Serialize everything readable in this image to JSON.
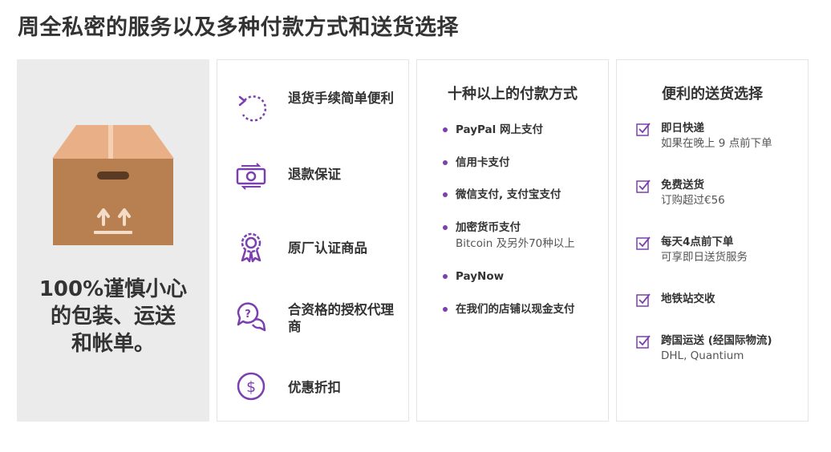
{
  "page": {
    "title": "周全私密的服务以及多种付款方式和送货选择"
  },
  "colors": {
    "accent": "#7b3fb0",
    "box_dark": "#b88050",
    "box_light": "#e9b088",
    "panel_bg": "#ebebeb"
  },
  "packaging": {
    "lines": [
      "100%谨慎小心",
      "的包装、运送",
      "和帐单。"
    ],
    "icon": "cardboard-box-icon"
  },
  "features": [
    {
      "label": "退货手续简单便利",
      "icon": "return-arrow-icon"
    },
    {
      "label": "退款保证",
      "icon": "money-refund-icon"
    },
    {
      "label": "原厂认证商品",
      "icon": "badge-ribbon-icon"
    },
    {
      "label": "合资格的授权代理商",
      "icon": "chat-question-icon"
    },
    {
      "label": "优惠折扣",
      "icon": "dollar-coin-icon"
    }
  ],
  "payment": {
    "heading": "十种以上的付款方式",
    "items": [
      {
        "main": "PayPal 网上支付",
        "sub": ""
      },
      {
        "main": "信用卡支付",
        "sub": ""
      },
      {
        "main": "微信支付, 支付宝支付",
        "sub": ""
      },
      {
        "main": "加密货币支付",
        "sub": "Bitcoin 及另外70种以上"
      },
      {
        "main": "PayNow",
        "sub": ""
      },
      {
        "main": "在我们的店铺以现金支付",
        "sub": ""
      }
    ]
  },
  "delivery": {
    "heading": "便利的送货选择",
    "items": [
      {
        "main": "即日快递",
        "sub": "如果在晚上 9 点前下单"
      },
      {
        "main": "免费送货",
        "sub": "订购超过€56"
      },
      {
        "main": "每天4点前下单",
        "sub": "可享即日送货服务"
      },
      {
        "main": "地铁站交收",
        "sub": ""
      },
      {
        "main": "跨国运送 (经国际物流)",
        "sub": "DHL, Quantium"
      }
    ]
  }
}
